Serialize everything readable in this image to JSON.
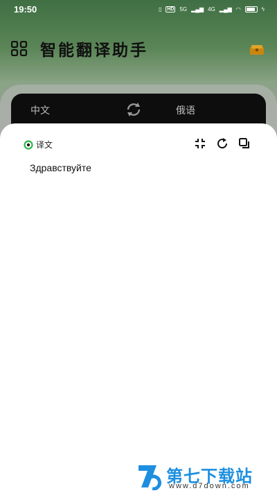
{
  "status_bar": {
    "time": "19:50",
    "hd_label": "HD",
    "net_5g": "5G",
    "net_4g": "4G"
  },
  "header": {
    "title": "智能翻译助手",
    "left_icon": "apps-grid-icon",
    "right_icon": "gift-box-icon"
  },
  "language_bar": {
    "source": "中文",
    "target": "俄语",
    "swap_icon": "swap-icon"
  },
  "result_sheet": {
    "label": "译文",
    "text": "Здравствуйте",
    "tools": [
      "collapse-icon",
      "replay-icon",
      "copy-icon"
    ]
  },
  "watermark": {
    "title": "第七下载站",
    "url": "www.d7down.com"
  },
  "colors": {
    "header_green": "#3f6f43",
    "lang_bar_bg": "#0d0d0d",
    "accent_green": "#2fb54a",
    "watermark_blue": "#1e8fe0"
  }
}
